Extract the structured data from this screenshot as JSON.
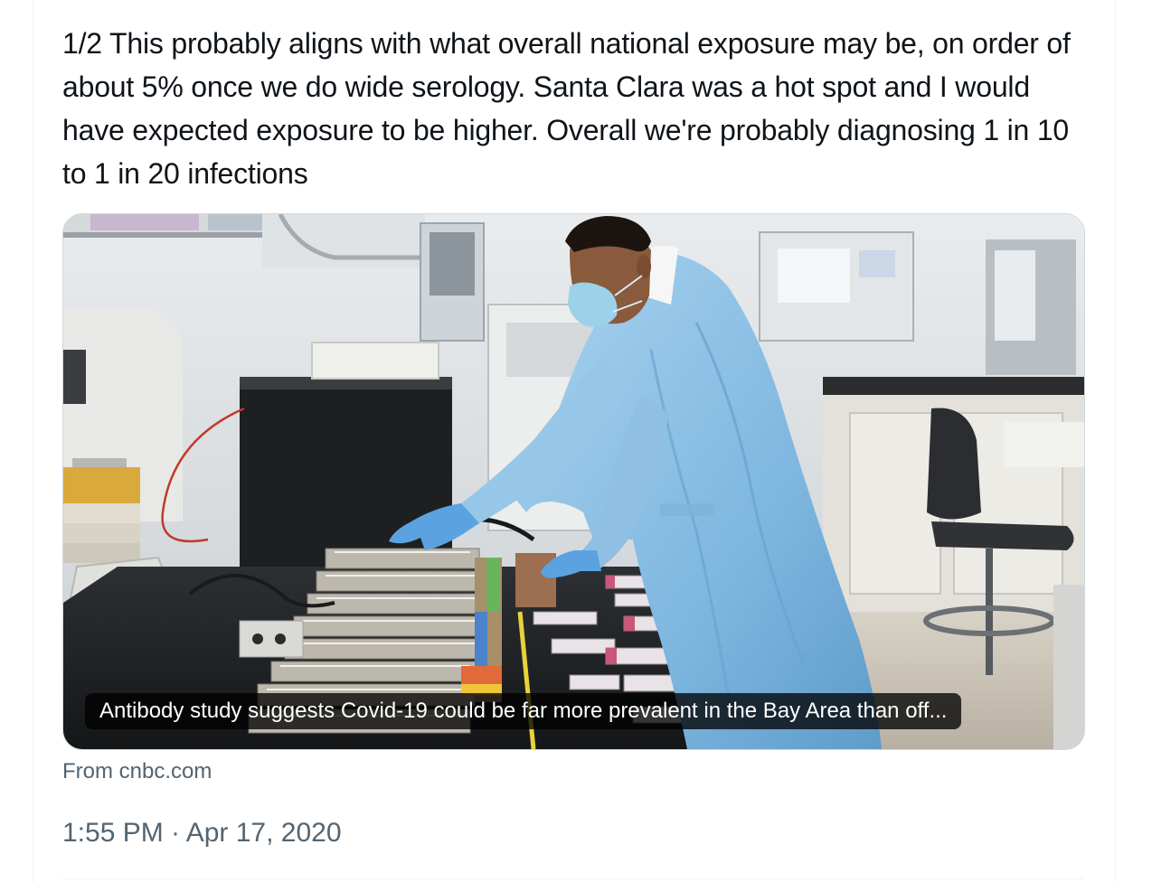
{
  "tweet": {
    "text": "1/2 This probably aligns with what overall national exposure may be, on order of about 5% once we do wide serology. Santa Clara was a hot spot and I would have expected exposure to be higher. Overall we're probably diagnosing 1 in 10 to 1 in 20 infections",
    "timestamp": "1:55 PM · Apr 17, 2020"
  },
  "card": {
    "headline": "Antibody study suggests Covid-19 could be far more prevalent in the Bay Area than off...",
    "source": "From cnbc.com"
  },
  "colors": {
    "text_primary": "#0f1419",
    "text_secondary": "#536471",
    "card_border": "#cfd9de",
    "caption_background": "rgba(0,0,0,0.77)",
    "gown_blue": "#8fc3e6",
    "glove_blue": "#5aa3e0"
  }
}
